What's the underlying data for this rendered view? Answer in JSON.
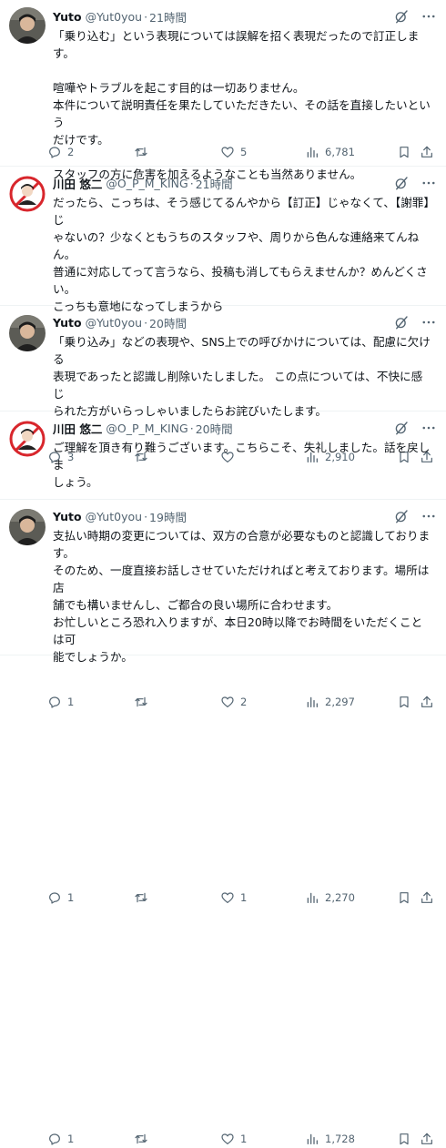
{
  "tweets": [
    {
      "name": "Yuto",
      "handle": "@Yut0you",
      "time": "21時間",
      "lines": [
        "「乗り込む」という表現については誤解を招く表現だったので訂正します。",
        "",
        "喧嘩やトラブルを起こす目的は一切ありません。",
        "本件について説明責任を果たしていただきたい、その話を直接したいという",
        "だけです。",
        "",
        "スタッフの方に危害を加えるようなことも当然ありません。"
      ],
      "replies": "2",
      "retweets": "",
      "likes": "5",
      "views": "6,781",
      "avatar": "yuto"
    },
    {
      "name": "川田 悠二",
      "handle": "@O_P_M_KING",
      "time": "21時間",
      "lines": [
        "だったら、こっちは、そう感じてるんやから【訂正】じゃなくて、【謝罪】じ",
        "ゃないの？少なくともうちのスタッフや、周りから色んな連絡来てんねん。",
        "普通に対応してって言うなら、投稿も消してもらえませんか？めんどくさ",
        "い。",
        "こっちも意地になってしまうから"
      ],
      "replies": "3",
      "retweets": "",
      "likes": "",
      "views": "2,910",
      "avatar": "kawada"
    },
    {
      "name": "Yuto",
      "handle": "@Yut0you",
      "time": "20時間",
      "lines": [
        "「乗り込み」などの表現や、SNS上での呼びかけについては、配慮に欠ける",
        "表現であったと認識し削除いたしました。 この点については、不快に感じ",
        "られた方がいらっしゃいましたらお詫びいたします。"
      ],
      "replies": "1",
      "retweets": "",
      "likes": "2",
      "views": "2,297",
      "avatar": "yuto"
    },
    {
      "name": "川田 悠二",
      "handle": "@O_P_M_KING",
      "time": "20時間",
      "lines": [
        "ご理解を頂き有り難うございます。こちらこそ、失礼しました。話を戻しま",
        "しょう。"
      ],
      "replies": "1",
      "retweets": "",
      "likes": "1",
      "views": "2,270",
      "avatar": "kawada"
    },
    {
      "name": "Yuto",
      "handle": "@Yut0you",
      "time": "19時間",
      "lines": [
        "支払い時期の変更については、双方の合意が必要なものと認識しておりま",
        "す。",
        "そのため、一度直接お話しさせていただければと考えております。場所は店",
        "舗でも構いませんし、ご都合の良い場所に合わせます。",
        "お忙しいところ恐れ入りますが、本日20時以降でお時間をいただくことは可",
        "能でしょうか。"
      ],
      "replies": "1",
      "retweets": "",
      "likes": "1",
      "views": "1,728",
      "avatar": "yuto"
    }
  ],
  "colors": {
    "text": "#0f1419",
    "secondary": "#536471",
    "divider": "#eff3f4",
    "kawada_avatar_red": "#d8262c"
  },
  "icons": {
    "grok": "grok-icon",
    "more": "more-icon",
    "reply": "reply-icon",
    "retweet": "retweet-icon",
    "like": "like-icon",
    "views": "views-icon",
    "bookmark": "bookmark-icon",
    "share": "share-icon"
  }
}
